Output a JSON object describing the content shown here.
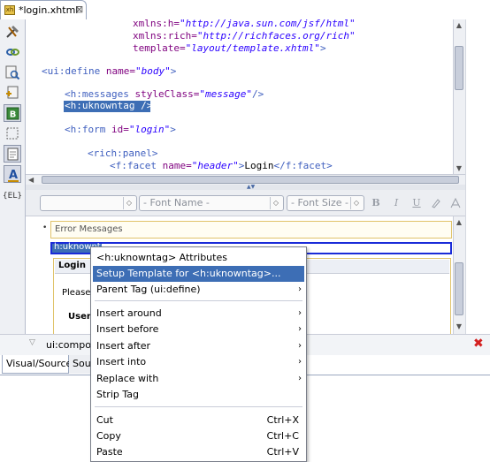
{
  "tab": {
    "title": "*login.xhtml",
    "close": "⊠"
  },
  "source_lines": {
    "l0_a": "xmlns:h=",
    "l0_b": "\"http://java.sun.com/jsf/html\"",
    "l1_a": "xmlns:rich=",
    "l1_b": "\"http://richfaces.org/rich\"",
    "l2_a": "template=",
    "l2_b": "\"layout/template.xhtml\"",
    "l2_c": ">",
    "l3_a": "<ui:define ",
    "l3_b": "name=",
    "l3_c": "\"body\"",
    "l3_d": ">",
    "l4_a": "<h:messages ",
    "l4_b": "styleClass=",
    "l4_c": "\"message\"",
    "l4_d": "/>",
    "l5": "<h:uknowntag />",
    "l6_a": "<h:form ",
    "l6_b": "id=",
    "l6_c": "\"login\"",
    "l6_d": ">",
    "l7": "<rich:panel>",
    "l8_a": "<f:facet ",
    "l8_b": "name=",
    "l8_c": "\"header\"",
    "l8_d": ">",
    "l8_e": "Login",
    "l8_f": "</f:facet>"
  },
  "toolbar": {
    "font_name": "- Font Name -",
    "font_size": "- Font Size -",
    "bold": "B",
    "italic": "I",
    "underline": "U"
  },
  "visual": {
    "bullet": "•",
    "error_messages": "Error Messages",
    "selected_tag": "h:uknowntag",
    "login_header": "Login",
    "please_text": "Please lo",
    "username": "Usern"
  },
  "bottom": {
    "composite_label": "ui:compos",
    "tab_visual_source": "Visual/Source",
    "tab_source": "Sou"
  },
  "menu": {
    "items": [
      {
        "label": "<h:uknowntag> Attributes"
      },
      {
        "label": "Setup Template for <h:uknowntag>..."
      },
      {
        "label": "Parent Tag (ui:define)"
      },
      {
        "label": "Insert around"
      },
      {
        "label": "Insert before"
      },
      {
        "label": "Insert after"
      },
      {
        "label": "Insert into"
      },
      {
        "label": "Replace with"
      },
      {
        "label": "Strip Tag"
      },
      {
        "label": "Cut",
        "accel": "Ctrl+X"
      },
      {
        "label": "Copy",
        "accel": "Ctrl+C"
      },
      {
        "label": "Paste",
        "accel": "Ctrl+V"
      }
    ],
    "submenu_arrow": "›"
  },
  "colors": {
    "selection": "#3d6eb5",
    "tag": "#3f5fbf",
    "attr": "#7f007f",
    "value": "#2a00ff"
  }
}
